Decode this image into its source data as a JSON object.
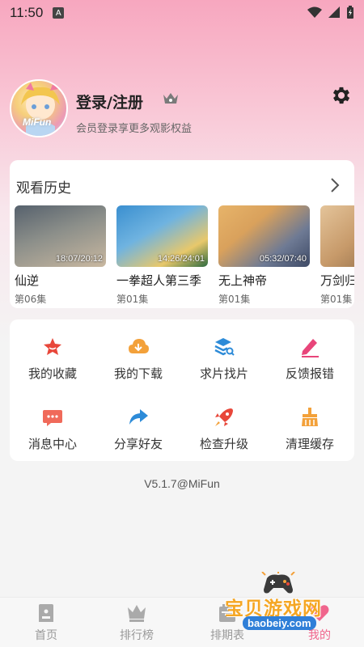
{
  "status": {
    "time": "11:50",
    "indicator": "A"
  },
  "profile": {
    "avatar_text": "MiFun",
    "title": "登录/注册",
    "subtitle": "会员登录享更多观影权益"
  },
  "history": {
    "title": "观看历史",
    "items": [
      {
        "name": "仙逆",
        "episode": "第06集",
        "time": "18:07/20:12",
        "color1": "#6a7580",
        "color2": "#c9b8a0"
      },
      {
        "name": "一拳超人第三季",
        "episode": "第01集",
        "time": "14:26/24:01",
        "color1": "#3a8fd0",
        "color2": "#e8c86b"
      },
      {
        "name": "无上神帝",
        "episode": "第01集",
        "time": "05:32/07:40",
        "color1": "#d9a15c",
        "color2": "#5a6a8a"
      },
      {
        "name": "万剑归宗",
        "episode": "第01集",
        "time": "",
        "color1": "#c79a6a",
        "color2": "#7a5a3a"
      }
    ]
  },
  "menu": {
    "items": [
      {
        "label": "我的收藏",
        "icon": "star-icon",
        "color": "#e8473a"
      },
      {
        "label": "我的下载",
        "icon": "download-icon",
        "color": "#f3a13a"
      },
      {
        "label": "求片找片",
        "icon": "search-layers-icon",
        "color": "#2d8bd8"
      },
      {
        "label": "反馈报错",
        "icon": "edit-icon",
        "color": "#e8457a"
      },
      {
        "label": "消息中心",
        "icon": "message-icon",
        "color": "#f06a5a"
      },
      {
        "label": "分享好友",
        "icon": "share-icon",
        "color": "#2d8bd8"
      },
      {
        "label": "检查升级",
        "icon": "rocket-icon",
        "color": "#e8473a"
      },
      {
        "label": "清理缓存",
        "icon": "broom-icon",
        "color": "#f3a13a"
      }
    ]
  },
  "version": "V5.1.7@MiFun",
  "nav": {
    "items": [
      {
        "label": "首页",
        "icon": "home-icon"
      },
      {
        "label": "排行榜",
        "icon": "crown-icon"
      },
      {
        "label": "排期表",
        "icon": "calendar-icon"
      },
      {
        "label": "我的",
        "icon": "heart-icon"
      }
    ]
  },
  "watermark": {
    "title": "宝贝游戏网",
    "url": "baobeiy.com"
  },
  "colors": {
    "accent": "#f0668d",
    "background": "#f4f4f4"
  }
}
